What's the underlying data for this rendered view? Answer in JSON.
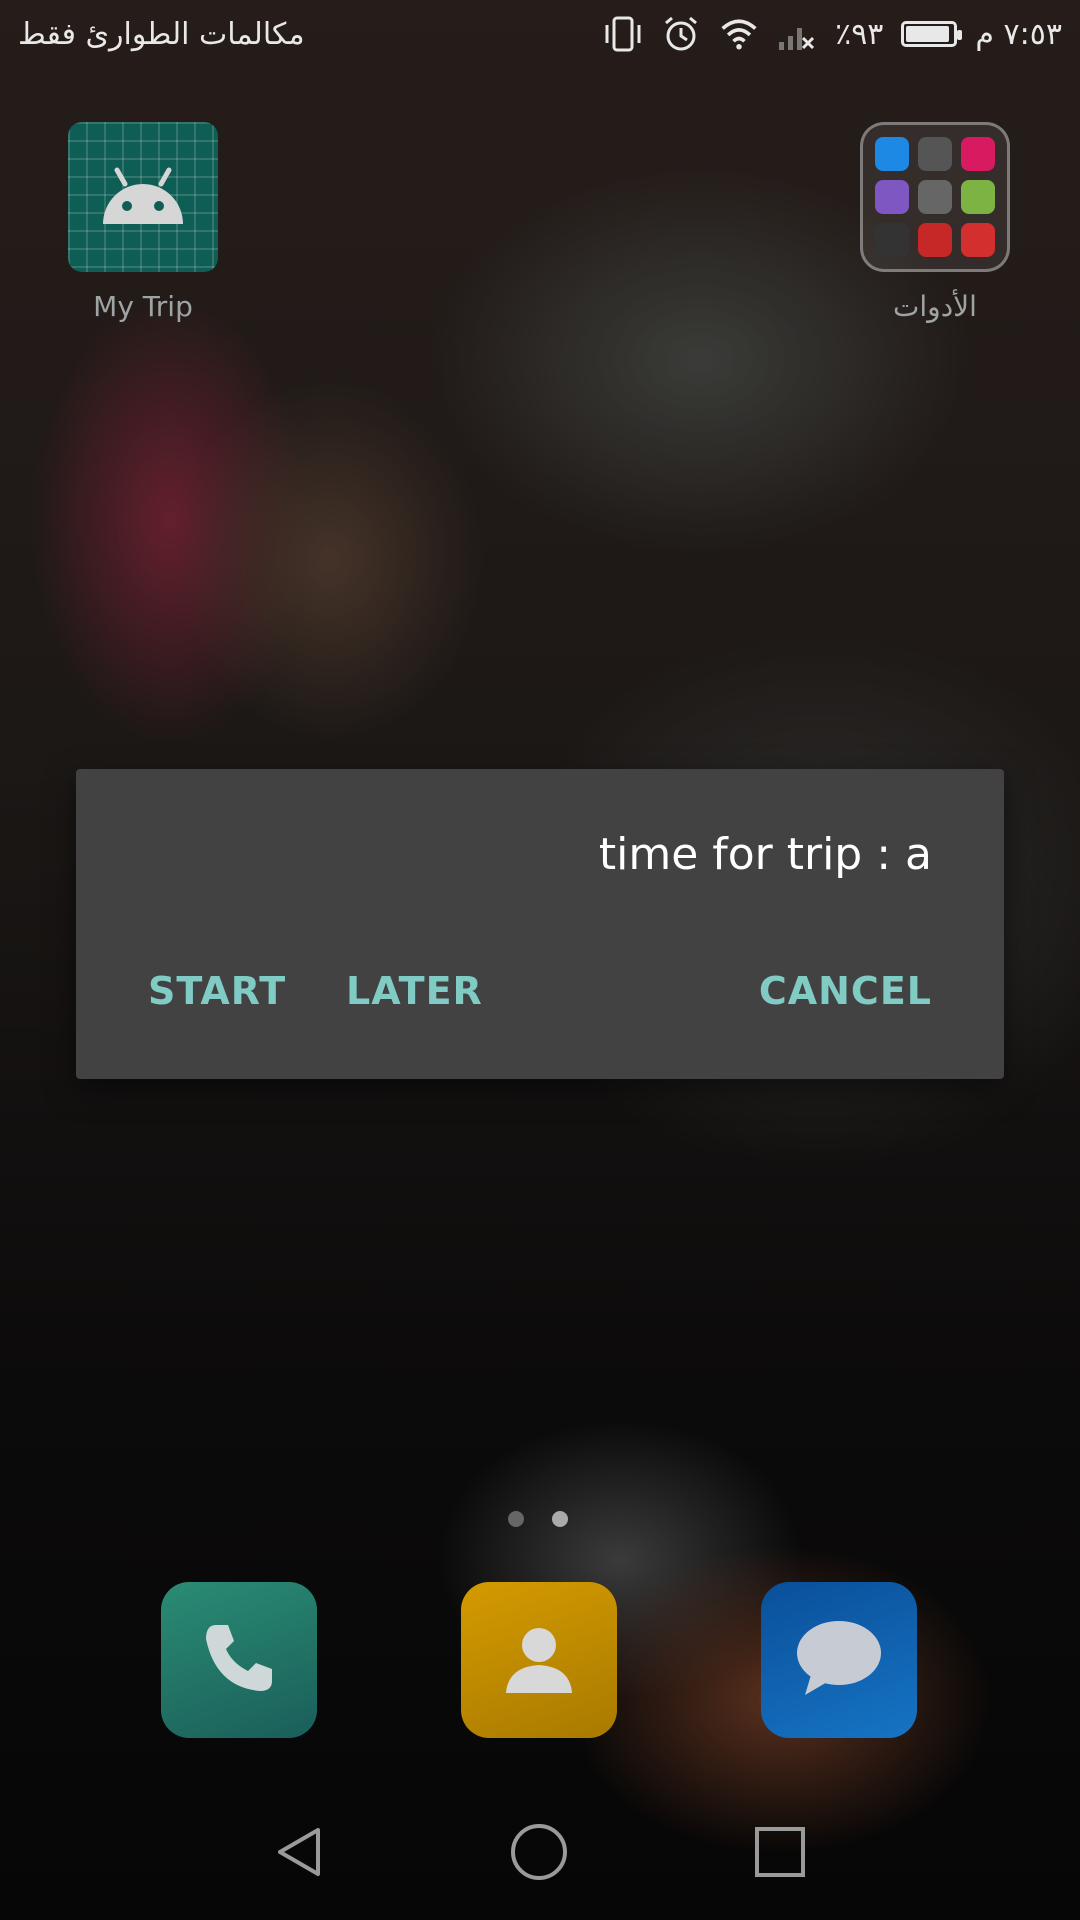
{
  "status_bar": {
    "carrier_text": "مكالمات الطوارئ فقط",
    "time": "٧:٥٣ م",
    "battery_percent": "٩٣٪",
    "battery_level": 0.93,
    "icons": [
      "vibrate-icon",
      "alarm-icon",
      "wifi-icon",
      "signal-icon",
      "battery-icon"
    ]
  },
  "home": {
    "apps": [
      {
        "label": "My Trip",
        "icon": "android-icon"
      },
      {
        "label": "الأدوات",
        "icon": "folder-icon"
      }
    ],
    "folder_mini_colors": [
      "#1e88e5",
      "#555555",
      "#d81b60",
      "#7e57c2",
      "#666666",
      "#7cb342",
      "#333333",
      "#c62828",
      "#d32f2f"
    ]
  },
  "dialog": {
    "message": "time for trip : a",
    "buttons": {
      "start": "START",
      "later": "LATER",
      "cancel": "CANCEL"
    },
    "accent_color": "#80cbc4"
  },
  "page_indicator": {
    "count": 2,
    "active_index": 1
  },
  "dock": [
    {
      "name": "phone-app",
      "icon": "phone-icon",
      "color": "#1f7a66"
    },
    {
      "name": "contacts-app",
      "icon": "contact-icon",
      "color": "#c28a00"
    },
    {
      "name": "messages-app",
      "icon": "message-icon",
      "color": "#0d5fa8"
    }
  ],
  "nav_bar": [
    "back-icon",
    "home-icon",
    "recents-icon"
  ]
}
